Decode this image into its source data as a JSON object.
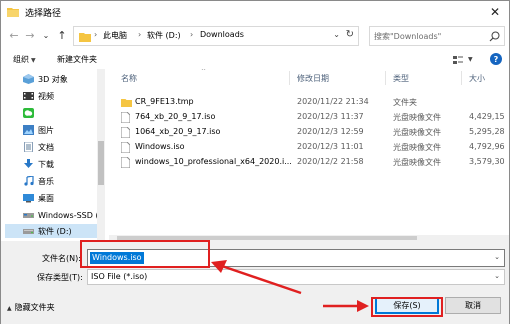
{
  "window": {
    "title": "选择路径",
    "close_glyph": "✕"
  },
  "nav": {
    "back_glyph": "←",
    "forward_glyph": "→",
    "recent_glyph": "⌄",
    "up_glyph": "↑",
    "breadcrumbs": [
      "此电脑",
      "软件 (D:)",
      "Downloads"
    ],
    "separator": "›",
    "dropdown_glyph": "⌄",
    "refresh_glyph": "↻",
    "search_placeholder": "搜索\"Downloads\""
  },
  "toolbar": {
    "organize_label": "组织",
    "new_folder_label": "新建文件夹",
    "caret": "▼",
    "help_glyph": "?"
  },
  "sidebar": {
    "items": [
      {
        "label": "3D 对象",
        "icon": "3d-objects-icon"
      },
      {
        "label": "视频",
        "icon": "video-icon"
      },
      {
        "label": "",
        "icon": "wechat-icon"
      },
      {
        "label": "图片",
        "icon": "pictures-icon"
      },
      {
        "label": "文档",
        "icon": "documents-icon"
      },
      {
        "label": "下载",
        "icon": "download-icon"
      },
      {
        "label": "音乐",
        "icon": "music-icon"
      },
      {
        "label": "桌面",
        "icon": "desktop-icon"
      },
      {
        "label": "Windows-SSD (",
        "icon": "drive-icon"
      },
      {
        "label": "软件 (D:)",
        "icon": "drive-icon",
        "selected": true
      }
    ]
  },
  "filelist": {
    "columns": {
      "name": "名称",
      "date": "修改日期",
      "type": "类型",
      "size": "大小"
    },
    "rows": [
      {
        "name": "CR_9FE13.tmp",
        "date": "2020/11/22 21:34",
        "type": "文件夹",
        "size": "",
        "kind": "folder"
      },
      {
        "name": "764_xb_20_9_17.iso",
        "date": "2020/12/3 11:37",
        "type": "光盘映像文件",
        "size": "4,429,15",
        "kind": "file"
      },
      {
        "name": "1064_xb_20_9_17.iso",
        "date": "2020/12/3 12:59",
        "type": "光盘映像文件",
        "size": "5,295,28",
        "kind": "file"
      },
      {
        "name": "Windows.iso",
        "date": "2020/12/3 11:01",
        "type": "光盘映像文件",
        "size": "4,792,96",
        "kind": "file"
      },
      {
        "name": "windows_10_professional_x64_2020.i...",
        "date": "2020/12/2 21:58",
        "type": "光盘映像文件",
        "size": "3,579,30",
        "kind": "file"
      }
    ]
  },
  "bottom": {
    "filename_label": "文件名(N):",
    "filename_value": "Windows.iso",
    "filetype_label": "保存类型(T):",
    "filetype_value": "ISO File (*.iso)",
    "dropdown_glyph": "⌄",
    "hide_folders_caret": "▲",
    "hide_folders_label": "隐藏文件夹",
    "save_label": "保存(S)",
    "cancel_label": "取消"
  },
  "colors": {
    "accent": "#0078d7",
    "annotation": "#e02020",
    "selected_bg": "#cce4f7"
  }
}
